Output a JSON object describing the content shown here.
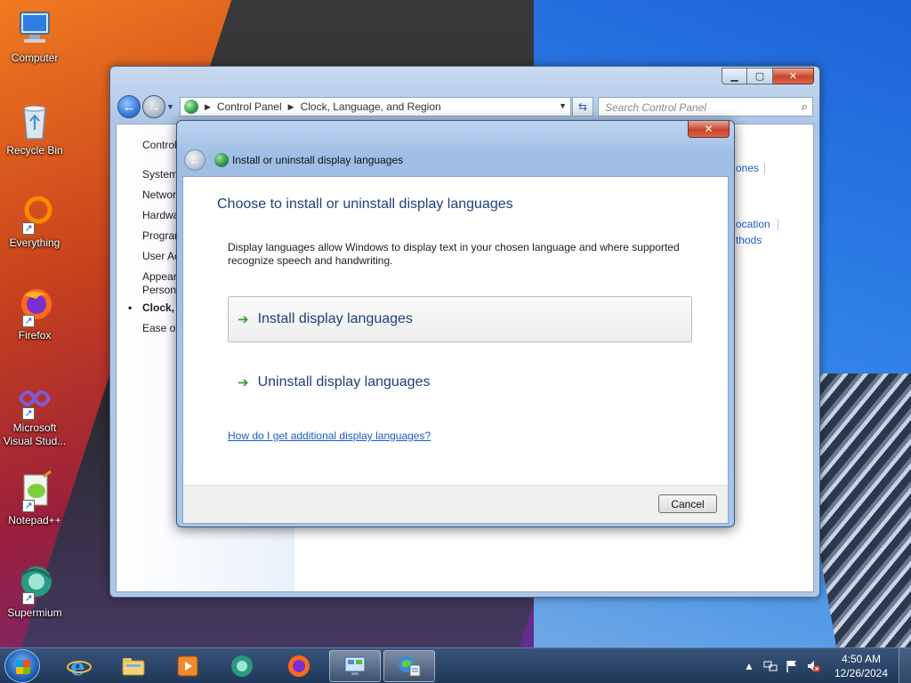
{
  "desktop": {
    "icons": [
      {
        "label": "Computer"
      },
      {
        "label": "Recycle Bin"
      },
      {
        "label": "Everything"
      },
      {
        "label": "Firefox"
      },
      {
        "label": "Microsoft Visual Stud..."
      },
      {
        "label": "Notepad++"
      },
      {
        "label": "Supermium"
      }
    ]
  },
  "cp_window": {
    "address": {
      "crumb1": "Control Panel",
      "crumb2": "Clock, Language, and Region"
    },
    "search_placeholder": "Search Control Panel",
    "sidebar": [
      {
        "label": "Control"
      },
      {
        "label": "System"
      },
      {
        "label": "Network"
      },
      {
        "label": "Hardwa"
      },
      {
        "label": "Program"
      },
      {
        "label": "User Ac"
      },
      {
        "label": "Appear"
      },
      {
        "label": "Persona"
      },
      {
        "label": "Clock, L"
      },
      {
        "label": "Ease of"
      }
    ],
    "right_links": [
      "ones",
      "ocation",
      "thods"
    ]
  },
  "dialog": {
    "close_label": "✕",
    "title": "Install or uninstall display languages",
    "heading": "Choose to install or uninstall display languages",
    "description": "Display languages allow Windows to display text in your chosen language and where supported recognize speech and handwriting.",
    "options": [
      {
        "label": "Install display languages"
      },
      {
        "label": "Uninstall display languages"
      }
    ],
    "help_link": "How do I get additional display languages?",
    "cancel_label": "Cancel"
  },
  "taskbar": {
    "time": "4:50 AM",
    "date": "12/26/2024"
  },
  "colors": {
    "link": "#1a5cc8",
    "heading": "#1e3f7a",
    "command_arrow": "#2f9a2f",
    "close_button": "#c9452c"
  }
}
